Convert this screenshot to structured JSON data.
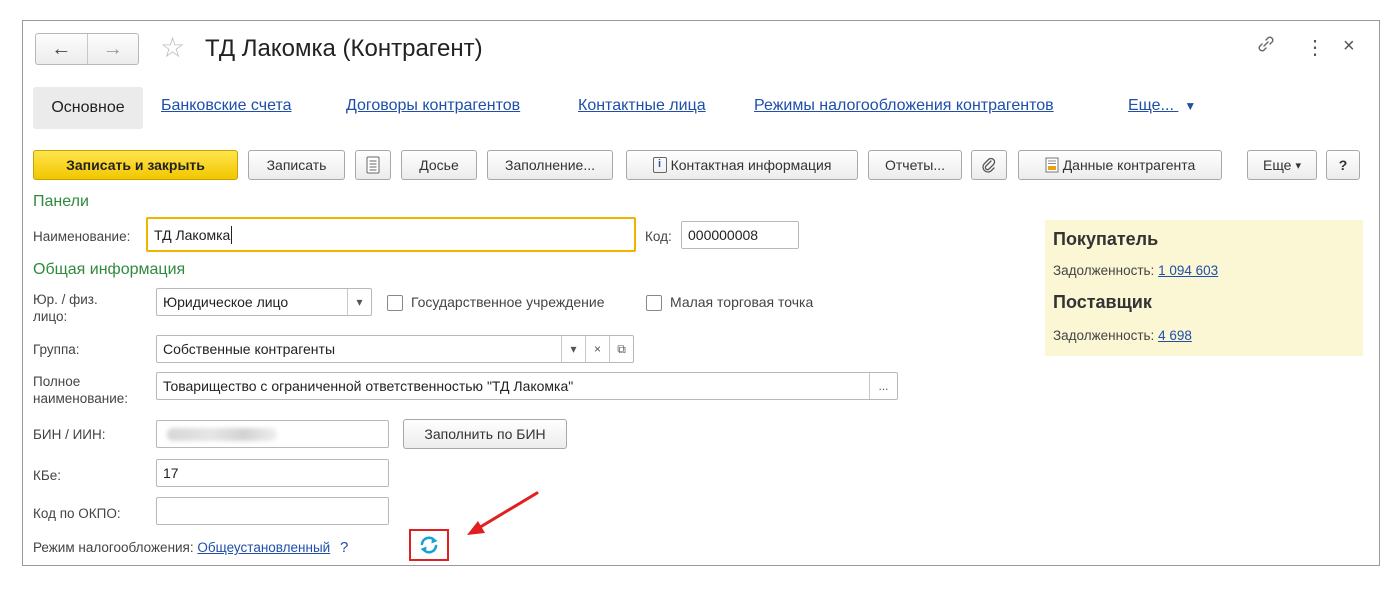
{
  "window": {
    "title": "ТД Лакомка (Контрагент)",
    "back_glyph": "←",
    "forward_glyph": "→",
    "star_glyph": "☆",
    "link_icon": "link-icon",
    "menu_glyph": "⋮",
    "close_glyph": "×"
  },
  "tabs": {
    "active": "Основное",
    "links": [
      "Банковские счета",
      "Договоры контрагентов",
      "Контактные лица",
      "Режимы налогообложения контрагентов"
    ],
    "more": "Еще...",
    "more_arrow": "▼"
  },
  "toolbar": {
    "save_close": "Записать и закрыть",
    "save": "Записать",
    "dossier": "Досье",
    "fill": "Заполнение...",
    "contact_info": "Контактная информация",
    "reports": "Отчеты...",
    "counterparty_data": "Данные контрагента",
    "more": "Еще",
    "more_arrow": "▾",
    "help": "?"
  },
  "form": {
    "panels_title": "Панели",
    "name_label": "Наименование:",
    "name_value": "ТД Лакомка",
    "code_label": "Код:",
    "code_value": "000000008",
    "general_title": "Общая информация",
    "entity_label_1": "Юр. / физ.",
    "entity_label_2": "лицо:",
    "entity_value": "Юридическое лицо",
    "state_institution": "Государственное учреждение",
    "small_retail": "Малая торговая точка",
    "group_label": "Группа:",
    "group_value": "Собственные контрагенты",
    "full_name_label_1": "Полное",
    "full_name_label_2": "наименование:",
    "full_name_value": "Товарищество с ограниченной ответственностью \"ТД Лакомка\"",
    "ellipsis": "...",
    "bin_label": "БИН / ИИН:",
    "fill_by_bin": "Заполнить по БИН",
    "kbe_label": "КБе:",
    "kbe_value": "17",
    "okpo_label": "Код по ОКПО:",
    "okpo_value": "",
    "tax_mode_label": "Режим налогообложения:",
    "tax_mode_value": "Общеустановленный",
    "tax_help": "?",
    "dropdown_glyph": "▾",
    "clear_glyph": "×",
    "open_glyph": "⧉"
  },
  "side_panel": {
    "buyer_title": "Покупатель",
    "buyer_debt_label": "Задолженность:",
    "buyer_debt_value": "1 094 603",
    "supplier_title": "Поставщик",
    "supplier_debt_label": "Задолженность:",
    "supplier_debt_value": "4 698"
  },
  "colors": {
    "accent_yellow": "#f2c700",
    "section_green": "#2f8a3e",
    "link_blue": "#1f4eab",
    "side_bg": "#fbf6d3",
    "highlight_red": "#e02020",
    "refresh_teal": "#1aa0d8"
  }
}
